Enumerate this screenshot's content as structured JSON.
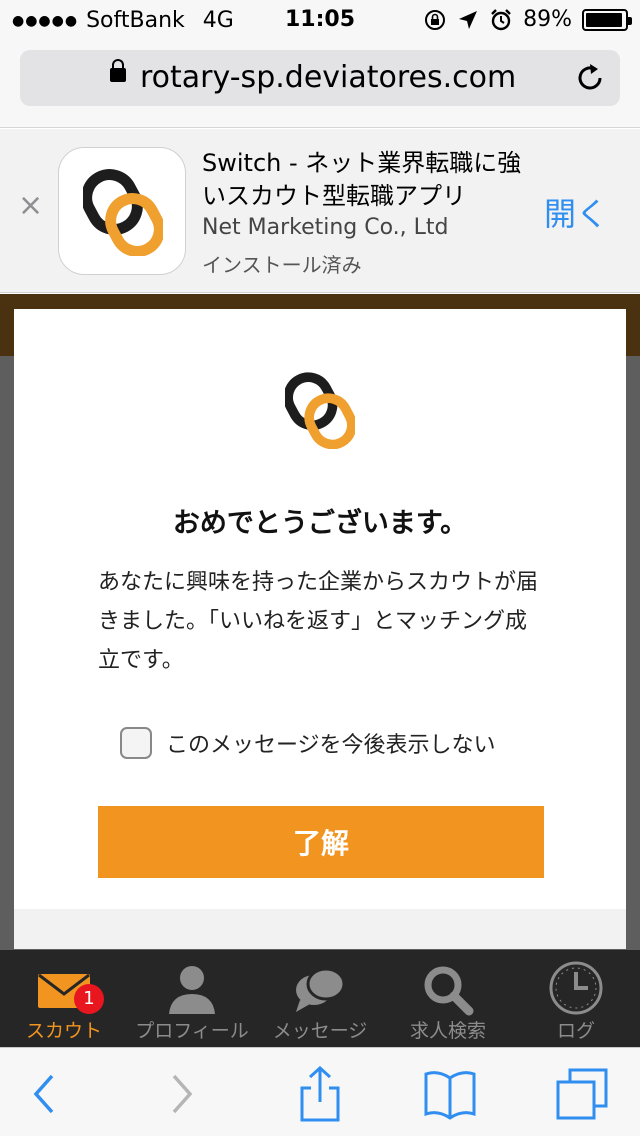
{
  "status_bar": {
    "signal": "●●●●●",
    "carrier": "SoftBank",
    "network": "4G",
    "time": "11:05",
    "battery": "89%"
  },
  "url_bar": {
    "url": "rotary-sp.deviatores.com"
  },
  "app_banner": {
    "close": "×",
    "title": "Switch - ネット業界転職に強いスカウト型転職アプリ",
    "developer": "Net Marketing Co., Ltd",
    "status": "インストール済み",
    "open_label": "開く"
  },
  "modal": {
    "title": "おめでとうございます。",
    "body": "あなたに興味を持った企業からスカウトが届きました。「いいねを返す」とマッチング成立です。",
    "checkbox_label": "このメッセージを今後表示しない",
    "checkbox_checked": false,
    "ok_label": "了解"
  },
  "tab_bar": {
    "tabs": [
      {
        "label": "スカウト",
        "icon": "mail-icon",
        "active": true,
        "badge": "1"
      },
      {
        "label": "プロフィール",
        "icon": "person-icon",
        "active": false
      },
      {
        "label": "メッセージ",
        "icon": "chat-bubble-icon",
        "active": false
      },
      {
        "label": "求人検索",
        "icon": "search-icon",
        "active": false
      },
      {
        "label": "ログ",
        "icon": "clock-icon",
        "active": false
      }
    ]
  },
  "colors": {
    "accent": "#f29420",
    "link_blue": "#2f8ef0",
    "badge_red": "#e8161e",
    "tab_bar_bg": "#262626"
  }
}
